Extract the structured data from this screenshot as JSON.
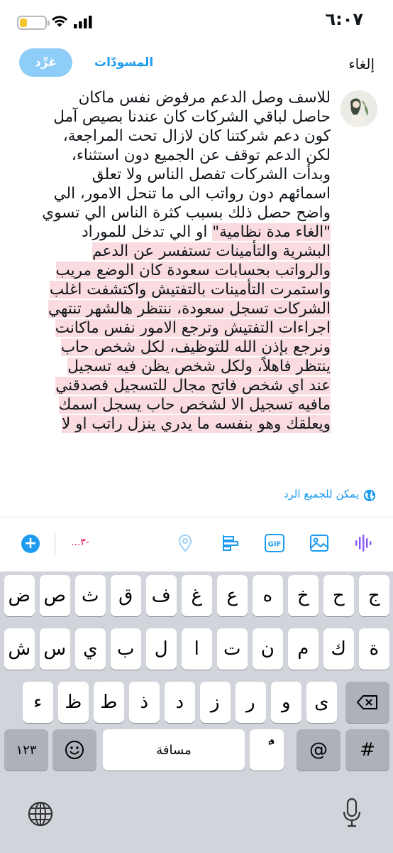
{
  "status_bar": {
    "time": "٦:٠٧",
    "battery_level": 0.28,
    "battery_color": "#f7c62f"
  },
  "header": {
    "cancel_label": "إلغاء",
    "drafts_label": "المسودّات",
    "tweet_label": "غرِّد"
  },
  "composer": {
    "lines": [
      {
        "text": "للاسف وصل الدعم مرفوض نفس ماكان",
        "over": false
      },
      {
        "text": "حاصل لباقي الشركات كان عندنا بصيص آمل",
        "over": false
      },
      {
        "text": "كون دعم شركتنا كان لازال تحت المراجعة،",
        "over": false
      },
      {
        "text": "لكن الدعم توقف عن الجميع دون استثناء،",
        "over": false
      },
      {
        "text": "وبدأت الشركات تفصل الناس ولا تعلق",
        "over": false
      },
      {
        "text": "اسمائهم دون رواتب الى ما تنحل الامور، الي",
        "over": false
      },
      {
        "text": "واضح حصل ذلك بسبب كثرة الناس الي تسوي",
        "over": false
      },
      {
        "text": "\"الغاء مدة نظامية\" او الي تدخل للموراد",
        "over": false,
        "over_part": "\"الغاء مدة نظامية\"",
        "rest_part": " او الي تدخل للموراد"
      },
      {
        "text": "البشرية والتأمينات تستفسر عن الدعم",
        "over": true
      },
      {
        "text": "والرواتب بحسابات سعودة كان الوضع مريب",
        "over": true
      },
      {
        "text": "واستمرت التأمينات بالتفتيش واكتشفت اغلب",
        "over": true
      },
      {
        "text": "الشركات تسجل سعودة، ننتظر هالشهر تنتهي",
        "over": true
      },
      {
        "text": "اجراءات التفتيش وترجع الامور نفس ماكانت",
        "over": true
      },
      {
        "text": "ونرجع بإذن الله للتوظيف، لكل شخص حاب",
        "over": true
      },
      {
        "text": "ينتظر فاهلاً، ولكل شخص يظن فيه تسجيل",
        "over": true
      },
      {
        "text": "عند اي شخص فاتح مجال للتسجيل فصدقني",
        "over": true
      },
      {
        "text": "مافيه تسجيل الا لشخص حاب يسجل اسمك",
        "over": true
      },
      {
        "text": "ويعلقك وهو بنفسه ما يدري ينزل راتب او لا",
        "over": true
      }
    ],
    "overflow_highlight_color": "#f9dbe0"
  },
  "reply_setting": {
    "label": "يمكن للجميع الرد",
    "icon": "globe-icon"
  },
  "toolbar": {
    "char_count": "-٣...",
    "icons": [
      "voice-icon",
      "image-icon",
      "gif-icon",
      "poll-icon",
      "location-icon",
      "add-icon"
    ],
    "gif_label": "GIF",
    "add_label": "+",
    "accent_color": "#1d9bf0"
  },
  "keyboard": {
    "row1": [
      "ج",
      "ح",
      "خ",
      "ه",
      "ع",
      "غ",
      "ف",
      "ق",
      "ث",
      "ص",
      "ض"
    ],
    "row2": [
      "ة",
      "ك",
      "م",
      "ن",
      "ت",
      "ا",
      "ل",
      "ب",
      "ي",
      "س",
      "ش"
    ],
    "row3": [
      "ى",
      "و",
      "ر",
      "ز",
      "د",
      "ذ",
      "ط",
      "ظ",
      "ء"
    ],
    "numbers_label": "١٢٣",
    "space_label": "مسافة",
    "tanween_label": "ًٌ",
    "at_label": "@",
    "hash_label": "#"
  }
}
